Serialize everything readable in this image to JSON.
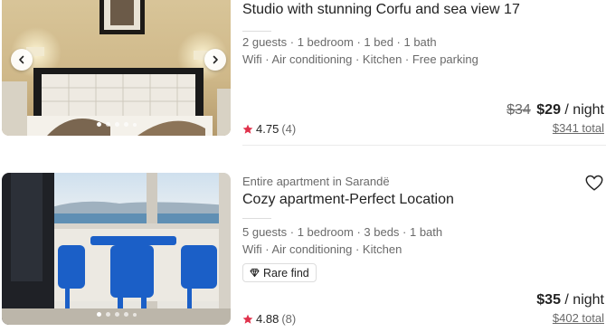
{
  "listings": [
    {
      "type_line": "",
      "title": "Studio with stunning Corfu and sea view 17",
      "details_1": "2 guests · 1 bedroom · 1 bed · 1 bath",
      "details_2": "Wifi · Air conditioning · Kitchen · Free parking",
      "badge": "",
      "rating": "4.75",
      "reviews": "(4)",
      "old_price": "$34",
      "price": "$29",
      "per": " / night",
      "total": "$341 total",
      "photo_dots": 5
    },
    {
      "type_line": "Entire apartment in Sarandë",
      "title": "Cozy apartment-Perfect Location",
      "details_1": "5 guests · 1 bedroom · 3 beds · 1 bath",
      "details_2": "Wifi · Air conditioning · Kitchen",
      "badge": "Rare find",
      "rating": "4.88",
      "reviews": "(8)",
      "old_price": "",
      "price": "$35",
      "per": " / night",
      "total": "$402 total",
      "photo_dots": 5
    }
  ],
  "icons": {
    "star": "star-icon",
    "heart": "heart-icon",
    "diamond": "diamond-icon",
    "prev": "chevron-left-icon",
    "next": "chevron-right-icon"
  },
  "colors": {
    "star": "#e0314b",
    "text": "#222222",
    "muted": "#6a6a6a"
  }
}
